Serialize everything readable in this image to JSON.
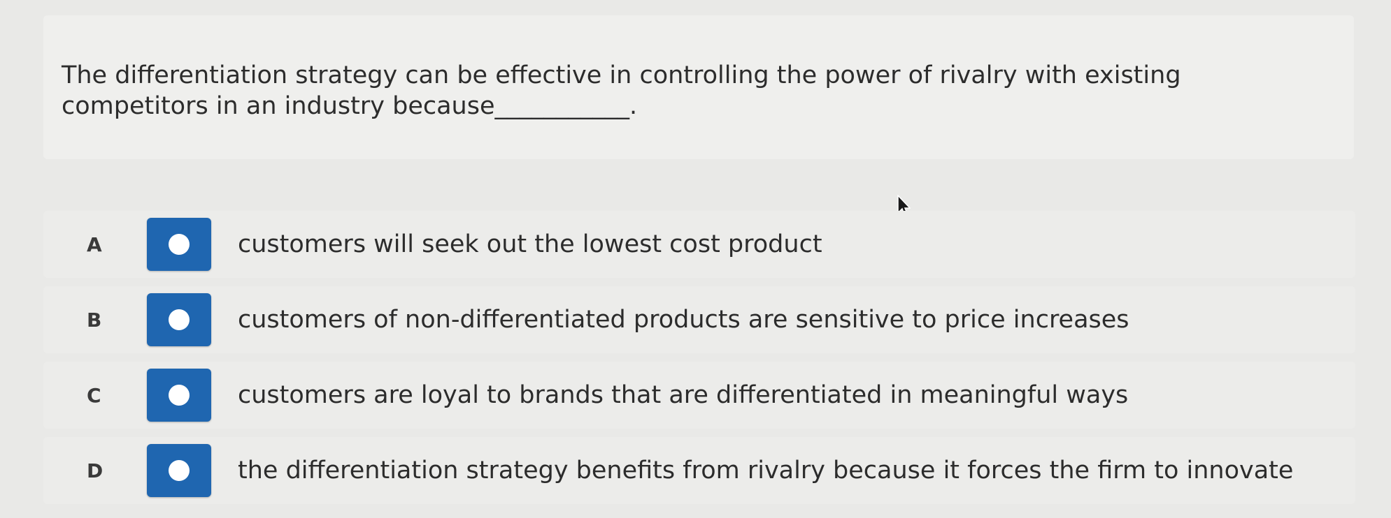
{
  "question": {
    "text": "The differentiation strategy can be effective in controlling the power of rivalry with existing competitors in an industry because___________."
  },
  "options": [
    {
      "letter": "A",
      "text": "customers will seek out the lowest cost product"
    },
    {
      "letter": "B",
      "text": "customers of non-differentiated products are sensitive to price increases"
    },
    {
      "letter": "C",
      "text": "customers are loyal to brands that are differentiated in meaningful ways"
    },
    {
      "letter": "D",
      "text": "the differentiation strategy benefits from rivalry because it forces the firm to innovate"
    }
  ],
  "colors": {
    "radio_button": "#1f66b0",
    "background": "#e9e9e7",
    "card": "#efefed"
  },
  "icons": {
    "cursor": "mouse-pointer-icon"
  }
}
